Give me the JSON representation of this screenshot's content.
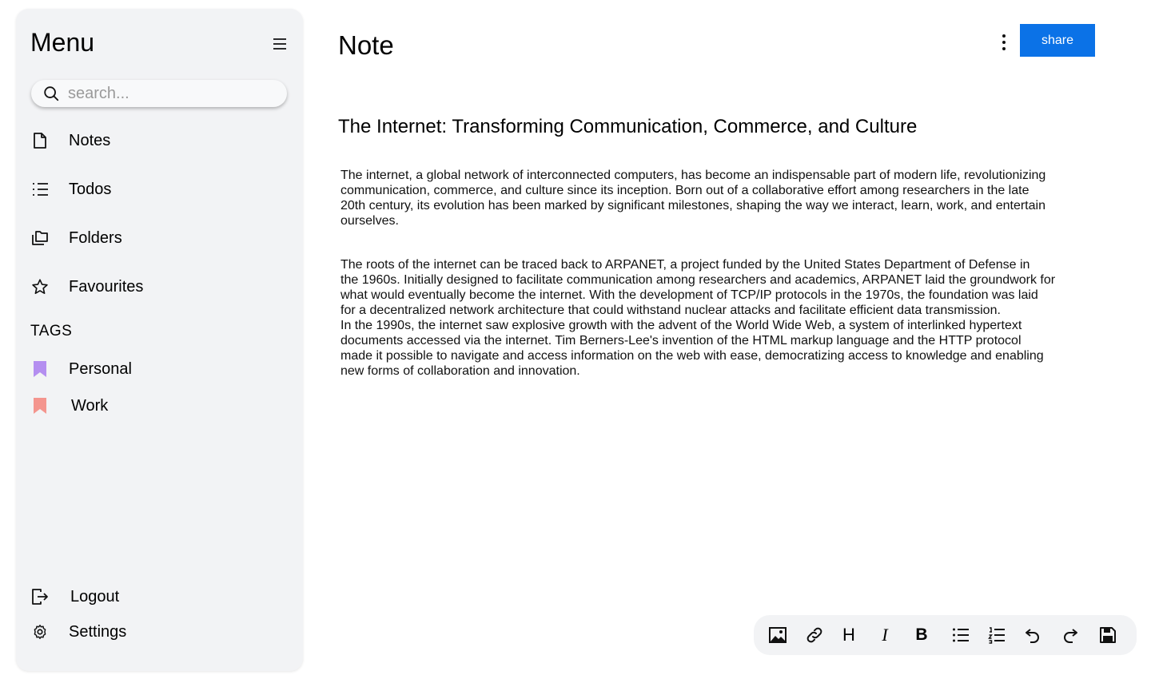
{
  "sidebar": {
    "title": "Menu",
    "search": {
      "placeholder": "search...",
      "value": ""
    },
    "nav": [
      {
        "label": "Notes",
        "icon": "file-icon"
      },
      {
        "label": "Todos",
        "icon": "list-icon"
      },
      {
        "label": "Folders",
        "icon": "folders-icon"
      },
      {
        "label": "Favourites",
        "icon": "star-icon"
      }
    ],
    "tags_title": "TAGS",
    "tags": [
      {
        "label": "Personal",
        "color": "#b48ef0"
      },
      {
        "label": "Work",
        "color": "#f4958e"
      }
    ],
    "bottom": [
      {
        "label": "Logout",
        "icon": "logout-icon"
      },
      {
        "label": "Settings",
        "icon": "gear-icon"
      }
    ]
  },
  "header": {
    "title": "Note",
    "share_label": "share",
    "accent": "#0b72e7"
  },
  "document": {
    "title": "The Internet: Transforming Communication, Commerce, and Culture",
    "paragraphs": [
      "The internet, a global network of interconnected computers, has become an indispensable part of modern life, revolutionizing\ncommunication, commerce, and culture since its inception. Born out of a collaborative effort among researchers in the late\n20th century, its evolution has been marked by significant milestones, shaping the way we interact, learn, work, and entertain\nourselves.",
      "The roots of the internet can be traced back to ARPANET, a project funded by the United States Department of Defense in\n the 1960s. Initially designed to facilitate communication among researchers and academics, ARPANET laid the groundwork for\nwhat would eventually become the internet. With the development of TCP/IP protocols in the 1970s, the foundation was laid\nfor a decentralized network architecture that could withstand nuclear attacks and facilitate efficient data transmission.\nIn the 1990s, the internet saw explosive growth with the advent of the World Wide Web, a system of interlinked hypertext\ndocuments accessed via the internet. Tim Berners-Lee's invention of the HTML markup language and the HTTP protocol\nmade it possible to navigate and access information on the web with ease, democratizing access to knowledge and enabling\nnew forms of collaboration and innovation."
    ]
  },
  "toolbar": {
    "items": [
      {
        "icon": "image-icon",
        "text": ""
      },
      {
        "icon": "link-icon",
        "text": ""
      },
      {
        "icon": "heading-icon",
        "text": "H"
      },
      {
        "icon": "italic-icon",
        "text": "I"
      },
      {
        "icon": "bold-icon",
        "text": "B"
      },
      {
        "icon": "bullet-list-icon",
        "text": ""
      },
      {
        "icon": "numbered-list-icon",
        "text": ""
      },
      {
        "icon": "undo-icon",
        "text": ""
      },
      {
        "icon": "redo-icon",
        "text": ""
      },
      {
        "icon": "save-icon",
        "text": ""
      }
    ]
  }
}
